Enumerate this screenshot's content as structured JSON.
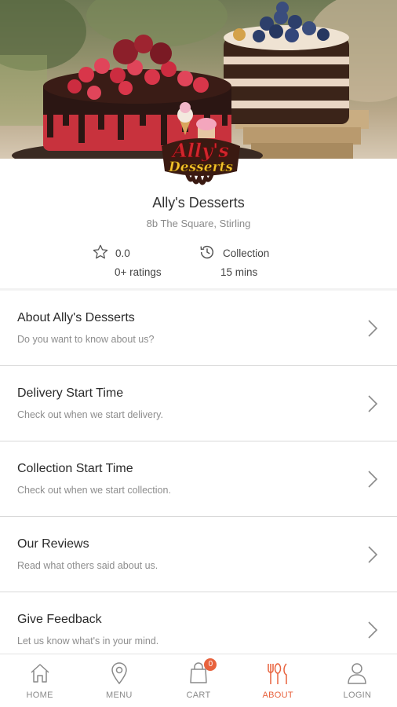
{
  "store": {
    "name": "Ally's Desserts",
    "address": "8b The Square, Stirling",
    "logo_text_top": "Ally's",
    "logo_text_bottom": "Desserts"
  },
  "stats": {
    "rating_value": "0.0",
    "rating_count": "0+ ratings",
    "rating_icon": "star-icon",
    "collection_label": "Collection",
    "collection_time": "15 mins",
    "collection_icon": "clock-icon"
  },
  "menu": {
    "items": [
      {
        "title": "About Ally's Desserts",
        "desc": "Do you want to know about us?"
      },
      {
        "title": "Delivery Start Time",
        "desc": "Check out when we start delivery."
      },
      {
        "title": "Collection Start Time",
        "desc": "Check out when we start collection."
      },
      {
        "title": "Our Reviews",
        "desc": "Read what others said about us."
      },
      {
        "title": "Give Feedback",
        "desc": "Let us know what's in your mind."
      }
    ]
  },
  "nav": {
    "items": [
      {
        "label": "HOME",
        "icon": "home-icon"
      },
      {
        "label": "MENU",
        "icon": "location-pin-icon"
      },
      {
        "label": "CART",
        "icon": "shopping-bag-icon",
        "badge": "0"
      },
      {
        "label": "ABOUT",
        "icon": "cutlery-icon",
        "active": true
      },
      {
        "label": "LOGIN",
        "icon": "user-icon"
      }
    ],
    "active_color": "#e8623d",
    "inactive_color": "#8a8a8a"
  }
}
